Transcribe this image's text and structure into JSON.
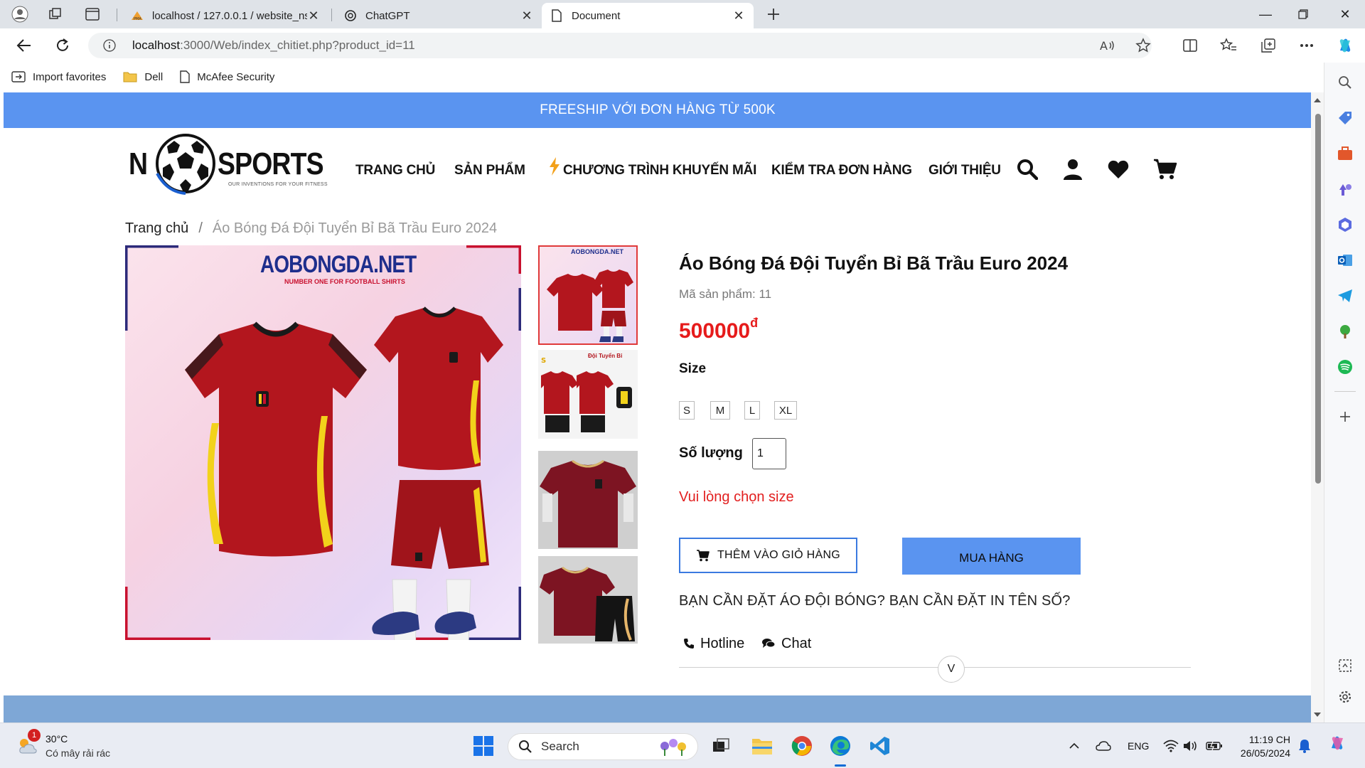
{
  "browser": {
    "tabs": [
      {
        "title": "localhost / 127.0.0.1 / website_ns",
        "active": false
      },
      {
        "title": "ChatGPT",
        "active": false
      },
      {
        "title": "Document",
        "active": true
      }
    ],
    "url_host": "localhost",
    "url_path": ":3000/Web/index_chitiet.php?product_id=11",
    "favorites": [
      "Import favorites",
      "Dell",
      "McAfee Security"
    ]
  },
  "page": {
    "promo": "FREESHIP VỚI ĐƠN HÀNG TỪ 500K",
    "logo": {
      "left": "N",
      "right": "SPORTS",
      "tagline": "OUR INVENTIONS FOR YOUR FITNESS"
    },
    "nav": [
      "TRANG CHỦ",
      "SẢN PHẨM",
      "CHƯƠNG TRÌNH KHUYẾN MÃI",
      "KIỂM TRA ĐƠN HÀNG",
      "GIỚI THIỆU"
    ],
    "breadcrumb": {
      "home": "Trang chủ",
      "separator": "/",
      "current": "Áo Bóng Đá Đội Tuyển Bỉ Bã Trầu Euro 2024"
    },
    "main_image_brand": "AOBONGDA.NET",
    "main_image_slogan": "NUMBER ONE FOR FOOTBALL SHIRTS",
    "thumb_labels": {
      "thumb1": "AOBONGDA.NET",
      "thumb2": "Đội Tuyển Bỉ"
    },
    "product": {
      "title": "Áo Bóng Đá Đội Tuyển Bỉ Bã Trầu Euro 2024",
      "code": "Mã sản phẩm: 11",
      "price": "500000",
      "currency": "đ",
      "size_label": "Size",
      "sizes": [
        "S",
        "M",
        "L",
        "XL"
      ],
      "qty_label": "Số lượng",
      "qty_value": "1",
      "warning": "Vui lòng chọn size",
      "add_to_cart": "THÊM VÀO GIỎ HÀNG",
      "buy_now": "MUA HÀNG",
      "note": "BẠN CẦN ĐẶT ÁO ĐỘI BÓNG? BẠN CẦN ĐẶT IN TÊN SỐ?",
      "hotline": "Hotline",
      "chat": "Chat",
      "expand": "V"
    },
    "colors": {
      "promo_bg": "#5a94f0",
      "price": "#e61b1b",
      "buy_bg": "#5a94f0",
      "cart_border": "#3b7ae0",
      "shirt": "#b3161e"
    }
  },
  "taskbar": {
    "weather_temp": "30°C",
    "weather_desc": "Có mây rải rác",
    "weather_badge": "1",
    "search": "Search",
    "lang": "ENG",
    "time": "11:19 CH",
    "date": "26/05/2024"
  }
}
